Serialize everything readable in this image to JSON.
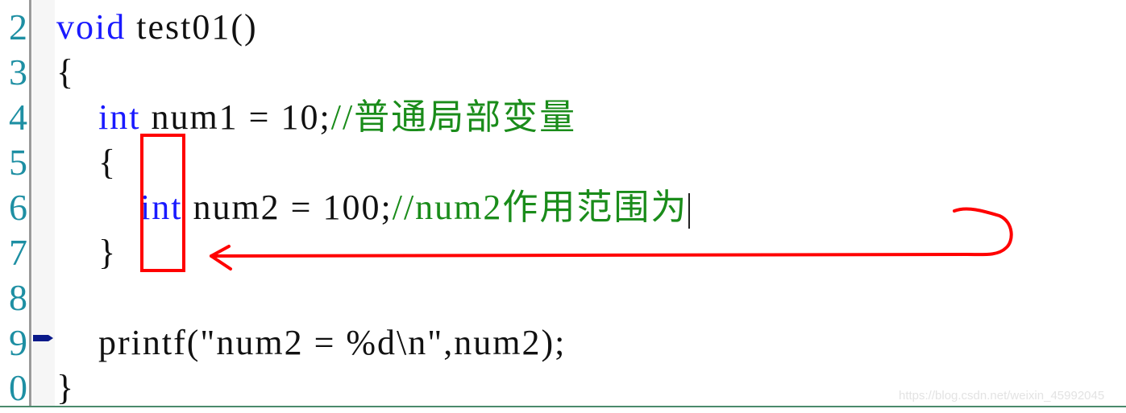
{
  "editor": {
    "lines": [
      {
        "number": "2",
        "indent": "",
        "parts": [
          {
            "type": "kw",
            "text": "void"
          },
          {
            "type": "plain",
            "text": " test01()"
          }
        ]
      },
      {
        "number": "3",
        "indent": "",
        "parts": [
          {
            "type": "plain",
            "text": "{"
          }
        ]
      },
      {
        "number": "4",
        "indent": "    ",
        "parts": [
          {
            "type": "kw",
            "text": "int"
          },
          {
            "type": "plain",
            "text": " num1 = 10;"
          },
          {
            "type": "cm",
            "text": "//普通局部变量"
          }
        ]
      },
      {
        "number": "5",
        "indent": "    ",
        "parts": [
          {
            "type": "plain",
            "text": "{"
          }
        ]
      },
      {
        "number": "6",
        "indent": "        ",
        "parts": [
          {
            "type": "kw",
            "text": "int"
          },
          {
            "type": "plain",
            "text": " num2 = 100;"
          },
          {
            "type": "cm",
            "text": "//num2作用范围为"
          }
        ],
        "cursor": true
      },
      {
        "number": "7",
        "indent": "    ",
        "parts": [
          {
            "type": "plain",
            "text": "}"
          }
        ]
      },
      {
        "number": "8",
        "indent": "",
        "parts": []
      },
      {
        "number": "9",
        "indent": "    ",
        "parts": [
          {
            "type": "plain",
            "text": "printf(\"num2 = %d\\n\",num2);"
          }
        ],
        "breakpoint_marker": true
      },
      {
        "number": "0",
        "indent": "",
        "parts": [
          {
            "type": "plain",
            "text": "}"
          }
        ]
      }
    ]
  },
  "annotation": {
    "color": "#ff0000",
    "description": "red box around inner block braces with arrow from comment"
  },
  "watermark": "https://blog.csdn.net/weixin_45992045"
}
